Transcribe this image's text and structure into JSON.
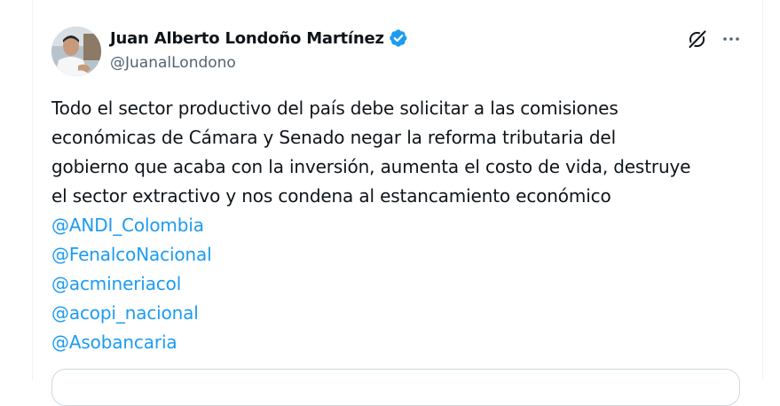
{
  "tweet": {
    "author_name": "Juan Alberto Londoño Martínez",
    "author_handle": "@JuanalLondono",
    "verified": true,
    "text_lines": [
      "Todo el sector productivo del país debe solicitar a las comisiones",
      "económicas de Cámara y Senado negar la reforma tributaria del",
      "gobierno que acaba con la inversión, aumenta el costo de vida, destruye",
      "el sector extractivo y nos condena al estancamiento económico"
    ],
    "mentions": [
      "@ANDI_Colombia",
      "@FenalcoNacional",
      "@acmineriacol",
      "@acopi_nacional",
      "@Asobancaria"
    ]
  },
  "icons": {
    "verified": "verified-badge-icon",
    "grok": "grok-icon",
    "more": "more-options-icon"
  },
  "colors": {
    "text": "#0f1419",
    "secondary": "#536471",
    "link": "#1d9bf0",
    "verified": "#1d9bf0",
    "border": "#eff3f4"
  }
}
